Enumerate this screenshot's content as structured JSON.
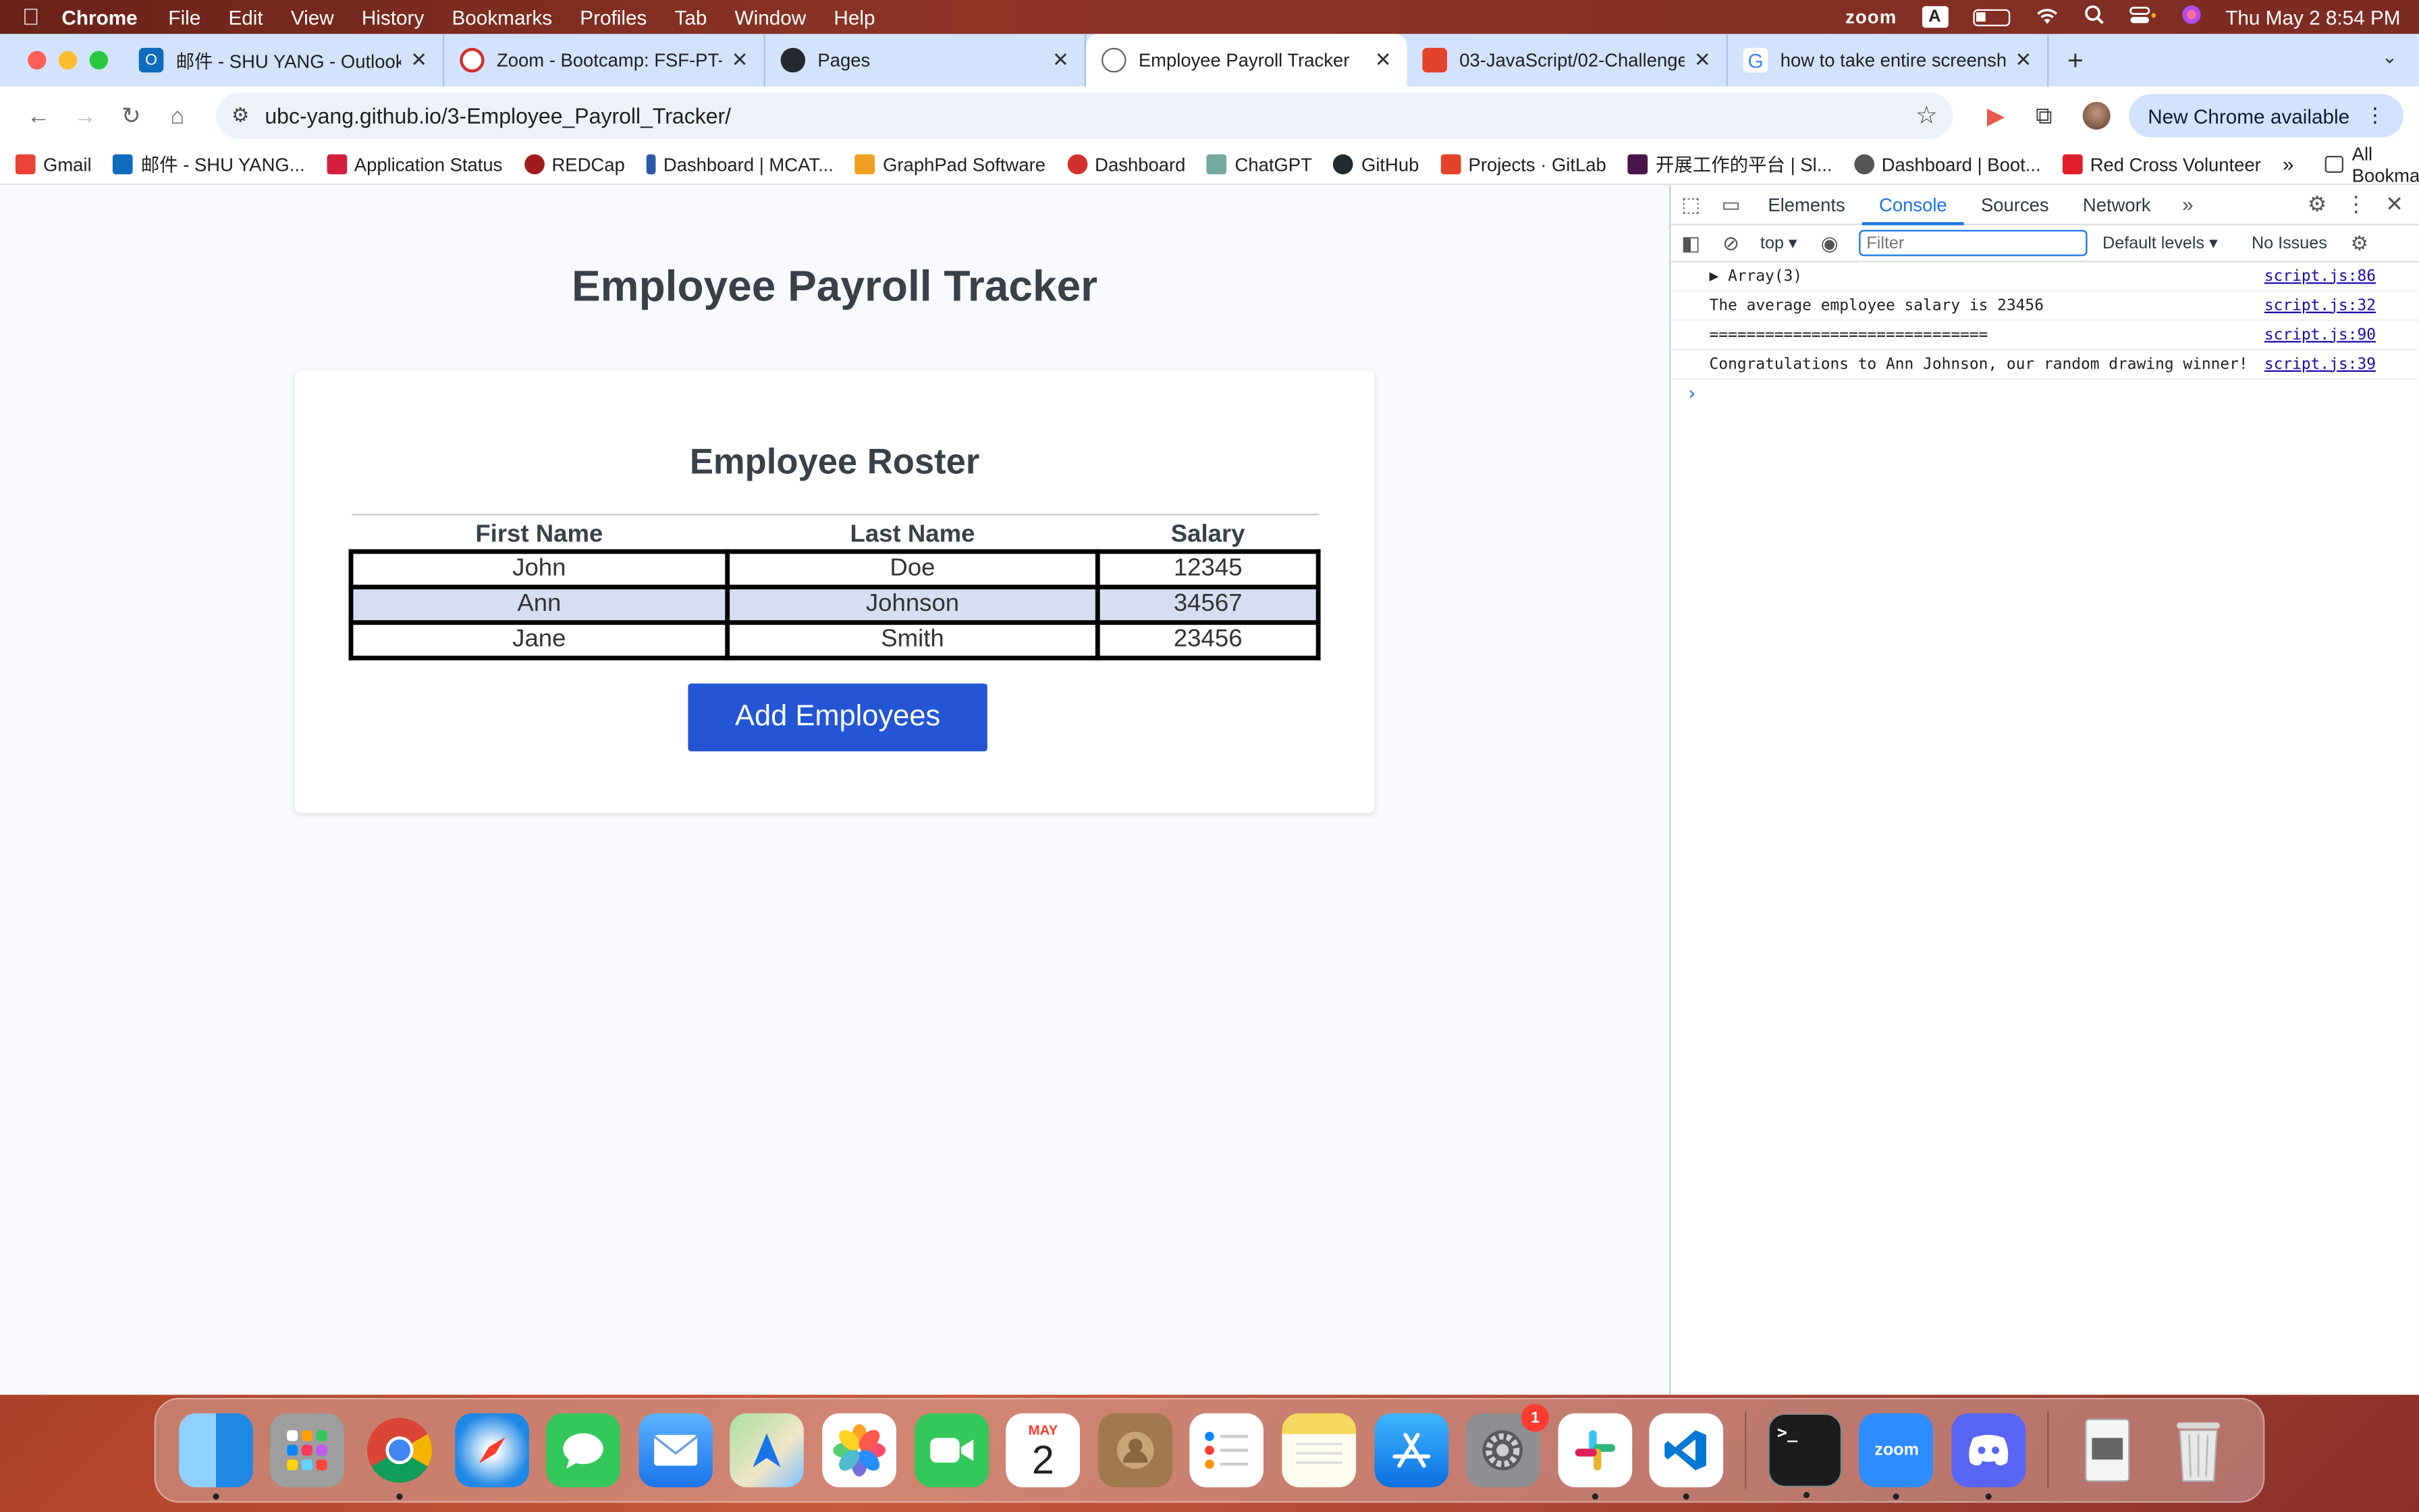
{
  "menubar": {
    "app": "Chrome",
    "items": [
      "File",
      "Edit",
      "View",
      "History",
      "Bookmarks",
      "Profiles",
      "Tab",
      "Window",
      "Help"
    ],
    "zoom": "zoom",
    "input_source": "A",
    "clock": "Thu May 2  8:54 PM"
  },
  "tabs": [
    {
      "title": "邮件 - SHU YANG - Outlook",
      "color": "#0f6cbd"
    },
    {
      "title": "Zoom - Bootcamp: FSF-PT-W",
      "color": "#d0312d"
    },
    {
      "title": "Pages",
      "color": "#24292f"
    },
    {
      "title": "Employee Payroll Tracker",
      "color": "#5f6368"
    },
    {
      "title": "03-JavaScript/02-Challenge",
      "color": "#e24329"
    },
    {
      "title": "how to take entire screensho",
      "color": "#4285f4"
    }
  ],
  "toolbar": {
    "url": "ubc-yang.github.io/3-Employee_Payroll_Tracker/",
    "new_chrome": "New Chrome available"
  },
  "bookmarks": [
    {
      "label": "Gmail",
      "color": "#ea4335"
    },
    {
      "label": "邮件 - SHU YANG...",
      "color": "#0f6cbd"
    },
    {
      "label": "Application Status",
      "color": "#d21f3c"
    },
    {
      "label": "REDCap",
      "color": "#a01c1c"
    },
    {
      "label": "Dashboard | MCAT...",
      "color": "#2a5ba8"
    },
    {
      "label": "GraphPad Software",
      "color": "#f0a020"
    },
    {
      "label": "Dashboard",
      "color": "#d0312d"
    },
    {
      "label": "ChatGPT",
      "color": "#74aa9c"
    },
    {
      "label": "GitHub",
      "color": "#24292f"
    },
    {
      "label": "Projects · GitLab",
      "color": "#e24329"
    },
    {
      "label": "开展工作的平台 | Sl...",
      "color": "#4a154b"
    },
    {
      "label": "Dashboard | Boot...",
      "color": "#555555"
    },
    {
      "label": "Red Cross Volunteer",
      "color": "#e11d2a"
    }
  ],
  "bookmarks_more": "»",
  "all_bookmarks": "All Bookmarks",
  "page": {
    "title": "Employee Payroll Tracker",
    "roster_title": "Employee Roster",
    "columns": [
      "First Name",
      "Last Name",
      "Salary"
    ],
    "rows": [
      [
        "John",
        "Doe",
        "12345"
      ],
      [
        "Ann",
        "Johnson",
        "34567"
      ],
      [
        "Jane",
        "Smith",
        "23456"
      ]
    ],
    "add_button": "Add Employees"
  },
  "devtools": {
    "tabs": [
      "Elements",
      "Console",
      "Sources",
      "Network"
    ],
    "active_tab": "Console",
    "context": "top",
    "filter_placeholder": "Filter",
    "levels": "Default levels",
    "issues": "No Issues",
    "lines": [
      {
        "msg": "▶ Array(3)",
        "src": "script.js:86"
      },
      {
        "msg": "The average employee salary is 23456",
        "src": "script.js:32"
      },
      {
        "msg": "==============================",
        "src": "script.js:90"
      },
      {
        "msg": "Congratulations to Ann Johnson, our random drawing winner!",
        "src": "script.js:39"
      }
    ],
    "prompt": "›"
  },
  "dock": {
    "apps": [
      {
        "name": "Finder",
        "color": "#1e88e5",
        "label": "",
        "running": true
      },
      {
        "name": "Launchpad",
        "color": "#9e9e9e",
        "label": "",
        "running": false
      },
      {
        "name": "Chrome",
        "color": "#e8eaed",
        "label": "",
        "running": true
      },
      {
        "name": "Safari",
        "color": "#1e88e5",
        "label": "",
        "running": false
      },
      {
        "name": "Messages",
        "color": "#34c759",
        "label": "",
        "running": false
      },
      {
        "name": "Mail",
        "color": "#3f8cf5",
        "label": "",
        "running": false
      },
      {
        "name": "Maps",
        "color": "#7cc868",
        "label": "",
        "running": false
      },
      {
        "name": "Photos",
        "color": "#f5f5f5",
        "label": "",
        "running": false
      },
      {
        "name": "FaceTime",
        "color": "#34c759",
        "label": "",
        "running": false
      },
      {
        "name": "Calendar",
        "color": "#ffffff",
        "label": "2",
        "running": false
      },
      {
        "name": "Contacts",
        "color": "#a07a4e",
        "label": "",
        "running": false
      },
      {
        "name": "Reminders",
        "color": "#ffffff",
        "label": "",
        "running": false
      },
      {
        "name": "Notes",
        "color": "#f6d860",
        "label": "",
        "running": false
      },
      {
        "name": "App Store",
        "color": "#1e88e5",
        "label": "",
        "running": false
      },
      {
        "name": "System Settings",
        "color": "#8e8e93",
        "label": "",
        "running": false,
        "badge": "1"
      },
      {
        "name": "Slack",
        "color": "#ffffff",
        "label": "",
        "running": true
      },
      {
        "name": "VS Code",
        "color": "#ffffff",
        "label": "",
        "running": true
      }
    ],
    "apps2": [
      {
        "name": "Terminal",
        "color": "#1c1c1e",
        "label": ">_",
        "running": true
      },
      {
        "name": "Zoom",
        "color": "#2d8cff",
        "label": "zoom",
        "running": true
      },
      {
        "name": "Discord",
        "color": "#5865f2",
        "label": "",
        "running": true
      }
    ],
    "apps3": [
      {
        "name": "Preview",
        "color": "#d8d8d8",
        "label": "",
        "running": false
      },
      {
        "name": "Trash",
        "color": "#c8c8c8",
        "label": "",
        "running": false
      }
    ],
    "calendar_month": "MAY"
  }
}
